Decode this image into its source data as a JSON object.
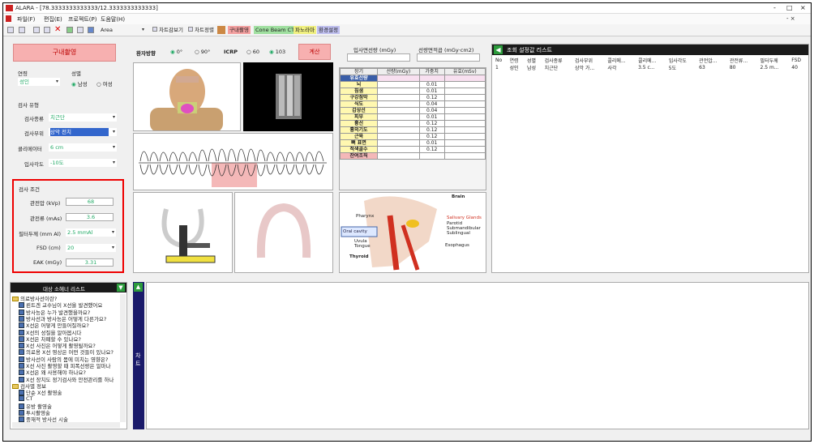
{
  "window": {
    "title": "ALARA - [78.3333333333333/12.3333333333333]",
    "controls": [
      "-",
      "□",
      "×"
    ]
  },
  "menu": [
    "파일(F)",
    "편집(E)",
    "프로젝트(P)",
    "도움말(H)"
  ],
  "toolbar": {
    "area_label": "Area",
    "buttons": [
      "차트감보기",
      "차트정렬"
    ],
    "tabs": [
      "구내촬영",
      "Cone Beam CT",
      "파노라마",
      "환경설정"
    ],
    "tab_colors": [
      "#f4a0a0",
      "#a0e0a0",
      "#f0f080",
      "#c0c0f0"
    ]
  },
  "left": {
    "mode_button": "구내촬영",
    "age_label": "연령",
    "age_value": "성인",
    "sex_label": "성별",
    "sex_options": [
      "남성",
      "여성"
    ],
    "exam_section": "검사 유형",
    "exam_type_label": "검사종류",
    "exam_type_value": "치근단",
    "exam_site_label": "검사부위",
    "exam_site_value": "상악 전치",
    "collimator_label": "콜리메이터",
    "collimator_value": "6 cm",
    "angle_label": "입사각도",
    "angle_value": "-10도",
    "cond_section": "검사 조건",
    "kvp_label": "관전압 (kVp)",
    "kvp_value": "68",
    "mas_label": "관전류 (mAs)",
    "mas_value": "3.6",
    "filter_label": "필터두께 (mm Al)",
    "filter_value": "2.5 mmAl",
    "fsd_label": "FSD (cm)",
    "fsd_value": "20",
    "eak_label": "EAK (mGy)",
    "eak_value": "3.31"
  },
  "center": {
    "patient_dir_label": "환자방향",
    "dir_options": [
      "0°",
      "90°"
    ],
    "icrp_label": "ICRP",
    "icrp_options": [
      "60",
      "103"
    ],
    "calc_button": "계산"
  },
  "dose": {
    "incident_label": "입사면선량 (mGy)",
    "dap_label": "선량면적곱 (mGy·cm2)",
    "headers": [
      "장기",
      "선량(mGy)",
      "가중치",
      "유효(mSv)"
    ],
    "rows": [
      [
        "유효선량",
        "",
        "",
        ""
      ],
      [
        "뇌",
        "",
        "0.01",
        ""
      ],
      [
        "침샘",
        "",
        "0.01",
        ""
      ],
      [
        "구강점막",
        "",
        "0.12",
        ""
      ],
      [
        "식도",
        "",
        "0.04",
        ""
      ],
      [
        "갑상선",
        "",
        "0.04",
        ""
      ],
      [
        "피부",
        "",
        "0.01",
        ""
      ],
      [
        "흉선",
        "",
        "0.12",
        ""
      ],
      [
        "흉외기도",
        "",
        "0.12",
        ""
      ],
      [
        "근육",
        "",
        "0.12",
        ""
      ],
      [
        "뼈 표면",
        "",
        "0.01",
        ""
      ],
      [
        "적색골수",
        "",
        "0.12",
        ""
      ],
      [
        "잔여조직",
        "",
        "",
        ""
      ]
    ]
  },
  "anatomy": {
    "labels": [
      "Brain",
      "Pharynx",
      "Salivary Glands",
      "Parotid",
      "Submandibular",
      "Sublingual",
      "Oral cavity",
      "Uvula",
      "Tongue",
      "Esophagus",
      "Thyroid"
    ]
  },
  "results": {
    "title": "조회 설정값 리스트",
    "headers": [
      "No",
      "연령",
      "성별",
      "검사종류",
      "검사부위",
      "콜리메...",
      "콜리메...",
      "입사각도",
      "관전압...",
      "관전류...",
      "필터두께",
      "FSD"
    ],
    "rows": [
      [
        "1",
        "성인",
        "남성",
        "치근단",
        "상악 가...",
        "사각",
        "3.5 c...",
        "5도",
        "63",
        "80",
        "2.5 m...",
        "40"
      ]
    ]
  },
  "scenario": {
    "title": "대상 소헤너 리스트",
    "items": [
      {
        "type": "folder",
        "text": "의료방사선이란?",
        "indent": 0
      },
      {
        "type": "doc",
        "text": "뢴트겐 교수님이 X선을 발견했어요",
        "indent": 1
      },
      {
        "type": "doc",
        "text": "방사능은 누가 발견했을까요?",
        "indent": 1
      },
      {
        "type": "doc",
        "text": "방사선과 방사능은 어떻게 다른가요?",
        "indent": 1
      },
      {
        "type": "doc",
        "text": "X선은 어떻게 만들어질까요?",
        "indent": 1
      },
      {
        "type": "doc",
        "text": "X선의 성질을 알아봅시다",
        "indent": 1
      },
      {
        "type": "doc",
        "text": "X선은 차폐할 수 있나요?",
        "indent": 1
      },
      {
        "type": "doc",
        "text": "X선 사진은 어떻게 촬영될까요?",
        "indent": 1
      },
      {
        "type": "doc",
        "text": "의료용 X선 영상은 어떤 것들이 있나요?",
        "indent": 1
      },
      {
        "type": "doc",
        "text": "방사선이 사람의 몸에 미치는 영향은?",
        "indent": 1
      },
      {
        "type": "doc",
        "text": "X선 사진 촬영할 때 피폭선량은 얼마나",
        "indent": 1
      },
      {
        "type": "doc",
        "text": "X선은 왜 사용해야 하나요?",
        "indent": 1
      },
      {
        "type": "doc",
        "text": "X선 장치도 정기검사와 안전관리를 하나",
        "indent": 1
      },
      {
        "type": "folder",
        "text": "검사별 정보",
        "indent": 0
      },
      {
        "type": "doc",
        "text": "단순 X선 촬영술",
        "indent": 1
      },
      {
        "type": "doc",
        "text": "CT",
        "indent": 1
      },
      {
        "type": "doc",
        "text": "유방 촬영술",
        "indent": 1
      },
      {
        "type": "doc",
        "text": "투시촬영술",
        "indent": 1
      },
      {
        "type": "doc",
        "text": "중재적 방사선 시술",
        "indent": 1
      }
    ]
  },
  "side_tab": {
    "text": "차트"
  }
}
